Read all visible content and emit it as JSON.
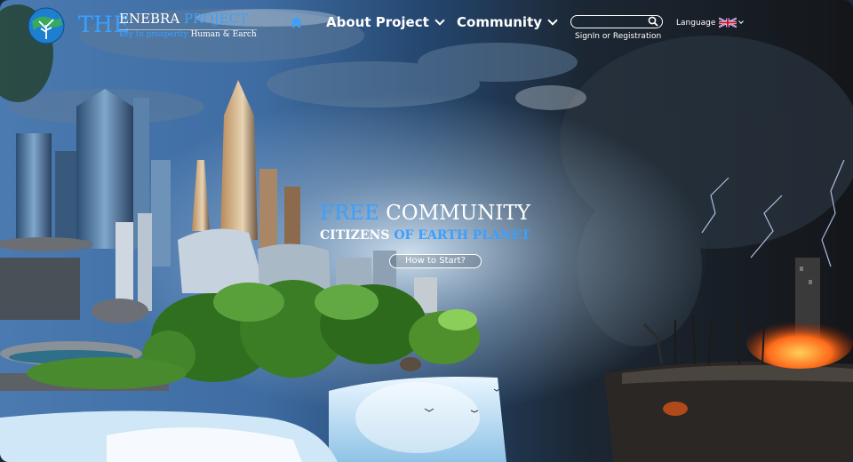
{
  "brand": {
    "the": "THE",
    "name_part1": "ENEBRA",
    "name_part2": "PROJECT",
    "tagline_part1": "key to prosperity",
    "tagline_part2": "Human & Earch",
    "logo_icon": "globe-tree-icon"
  },
  "nav": {
    "home_icon": "home-icon",
    "items": [
      {
        "label": "About Project",
        "icon": "chevron-down-icon"
      },
      {
        "label": "Community",
        "icon": "chevron-down-icon"
      }
    ]
  },
  "search": {
    "value": "",
    "placeholder": "",
    "icon": "search-icon"
  },
  "account": {
    "signin_label": "SignIn or Registration"
  },
  "language": {
    "label": "Language",
    "flag_icon": "uk-flag-icon",
    "icon": "chevron-down-icon"
  },
  "hero": {
    "free": "FREE",
    "community": "COMMUNITY",
    "citizens": "CITIZENS",
    "of_earth_planet": "OF EARTH PLANET",
    "cta_label": "How to Start?"
  },
  "colors": {
    "accent": "#3aa0ff",
    "text": "#ffffff"
  }
}
